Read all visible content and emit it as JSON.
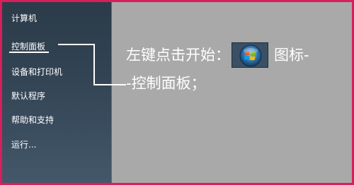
{
  "start_menu": {
    "items": [
      {
        "label": "计算机"
      },
      {
        "label": "控制面板"
      },
      {
        "label": "设备和打印机"
      },
      {
        "label": "默认程序"
      },
      {
        "label": "帮助和支持"
      },
      {
        "label": "运行..."
      }
    ]
  },
  "instruction": {
    "line1_before": "左键点击开始：",
    "line1_after": "图标-",
    "line2": "-控制面板；"
  },
  "icons": {
    "start_orb": "windows-start-orb-icon"
  },
  "colors": {
    "border": "#d81e5b",
    "background": "#a9a9a9",
    "panel": "#314252",
    "text": "#ffffff"
  }
}
